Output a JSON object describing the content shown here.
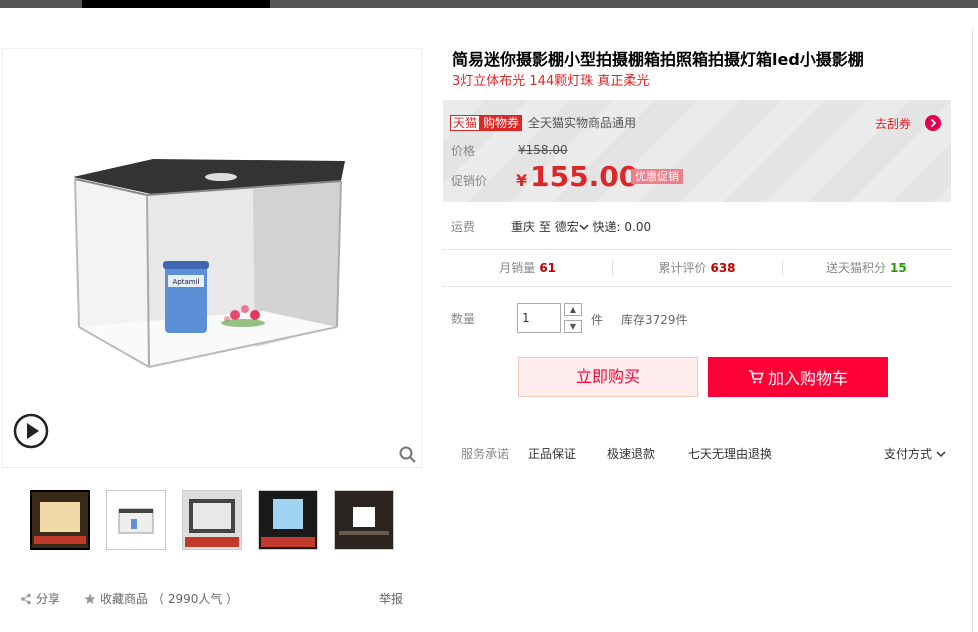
{
  "product": {
    "title": "简易迷你摄影棚小型拍摄棚箱拍照箱拍摄灯箱led小摄影棚",
    "subtitle": "3灯立体布光 144颗灯珠 真正柔光"
  },
  "coupon": {
    "tag_tmall": "天猫",
    "tag_voucher": "购物券",
    "text": "全天猫实物商品通用",
    "get_label": "去刮券"
  },
  "price": {
    "price_label": "价格",
    "original": "¥158.00",
    "promo_label": "促销价",
    "currency": "¥",
    "current": "155.00",
    "promo_tag": "优惠促销"
  },
  "shipping": {
    "label": "运费",
    "from": "重庆",
    "to_word": "至",
    "to": "德宏",
    "method": "快递: 0.00"
  },
  "stats": [
    {
      "label": "月销量",
      "value": "61",
      "style": "n"
    },
    {
      "label": "累计评价",
      "value": "638",
      "style": "n"
    },
    {
      "label": "送天猫积分",
      "value": "15",
      "style": "g"
    }
  ],
  "quantity": {
    "label": "数量",
    "value": "1",
    "unit": "件",
    "stock": "库存3729件"
  },
  "actions": {
    "buy_now": "立即购买",
    "add_cart": "加入购物车"
  },
  "services": {
    "label": "服务承诺",
    "items": [
      "正品保证",
      "极速退款",
      "七天无理由退换"
    ],
    "payment": "支付方式"
  },
  "social": {
    "share": "分享",
    "favorite": "收藏商品",
    "popularity": "（ 2990人气 ）",
    "report": "举报"
  },
  "product_image_text": "Aptamil",
  "colors": {
    "accent": "#ff0036",
    "price_red": "#dd2727"
  }
}
